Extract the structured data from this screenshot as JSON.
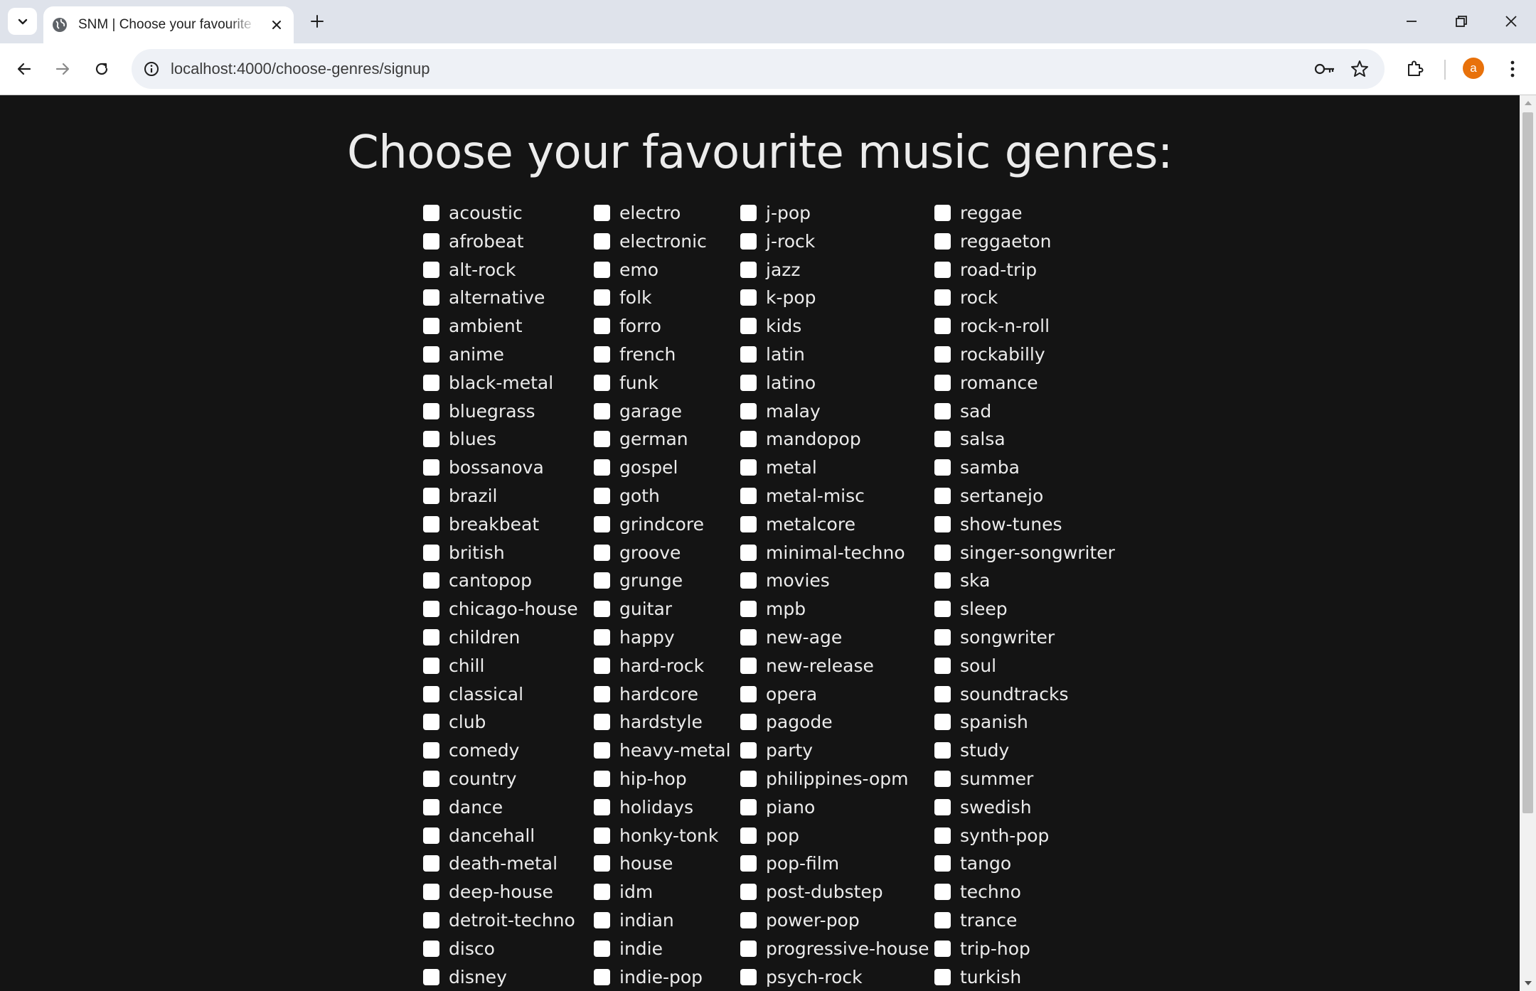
{
  "browser": {
    "tab_title": "SNM | Choose your favourite genres",
    "url": "localhost:4000/choose-genres/signup",
    "profile_initial": "a",
    "accent_color": "#e8710a"
  },
  "page": {
    "title": "Choose your favourite music genres:"
  },
  "genres": {
    "col1": [
      "acoustic",
      "afrobeat",
      "alt-rock",
      "alternative",
      "ambient",
      "anime",
      "black-metal",
      "bluegrass",
      "blues",
      "bossanova",
      "brazil",
      "breakbeat",
      "british",
      "cantopop",
      "chicago-house",
      "children",
      "chill",
      "classical",
      "club",
      "comedy",
      "country",
      "dance",
      "dancehall",
      "death-metal",
      "deep-house",
      "detroit-techno",
      "disco",
      "disney"
    ],
    "col2": [
      "electro",
      "electronic",
      "emo",
      "folk",
      "forro",
      "french",
      "funk",
      "garage",
      "german",
      "gospel",
      "goth",
      "grindcore",
      "groove",
      "grunge",
      "guitar",
      "happy",
      "hard-rock",
      "hardcore",
      "hardstyle",
      "heavy-metal",
      "hip-hop",
      "holidays",
      "honky-tonk",
      "house",
      "idm",
      "indian",
      "indie",
      "indie-pop"
    ],
    "col3": [
      "j-pop",
      "j-rock",
      "jazz",
      "k-pop",
      "kids",
      "latin",
      "latino",
      "malay",
      "mandopop",
      "metal",
      "metal-misc",
      "metalcore",
      "minimal-techno",
      "movies",
      "mpb",
      "new-age",
      "new-release",
      "opera",
      "pagode",
      "party",
      "philippines-opm",
      "piano",
      "pop",
      "pop-film",
      "post-dubstep",
      "power-pop",
      "progressive-house",
      "psych-rock"
    ],
    "col4": [
      "reggae",
      "reggaeton",
      "road-trip",
      "rock",
      "rock-n-roll",
      "rockabilly",
      "romance",
      "sad",
      "salsa",
      "samba",
      "sertanejo",
      "show-tunes",
      "singer-songwriter",
      "ska",
      "sleep",
      "songwriter",
      "soul",
      "soundtracks",
      "spanish",
      "study",
      "summer",
      "swedish",
      "synth-pop",
      "tango",
      "techno",
      "trance",
      "trip-hop",
      "turkish"
    ]
  }
}
